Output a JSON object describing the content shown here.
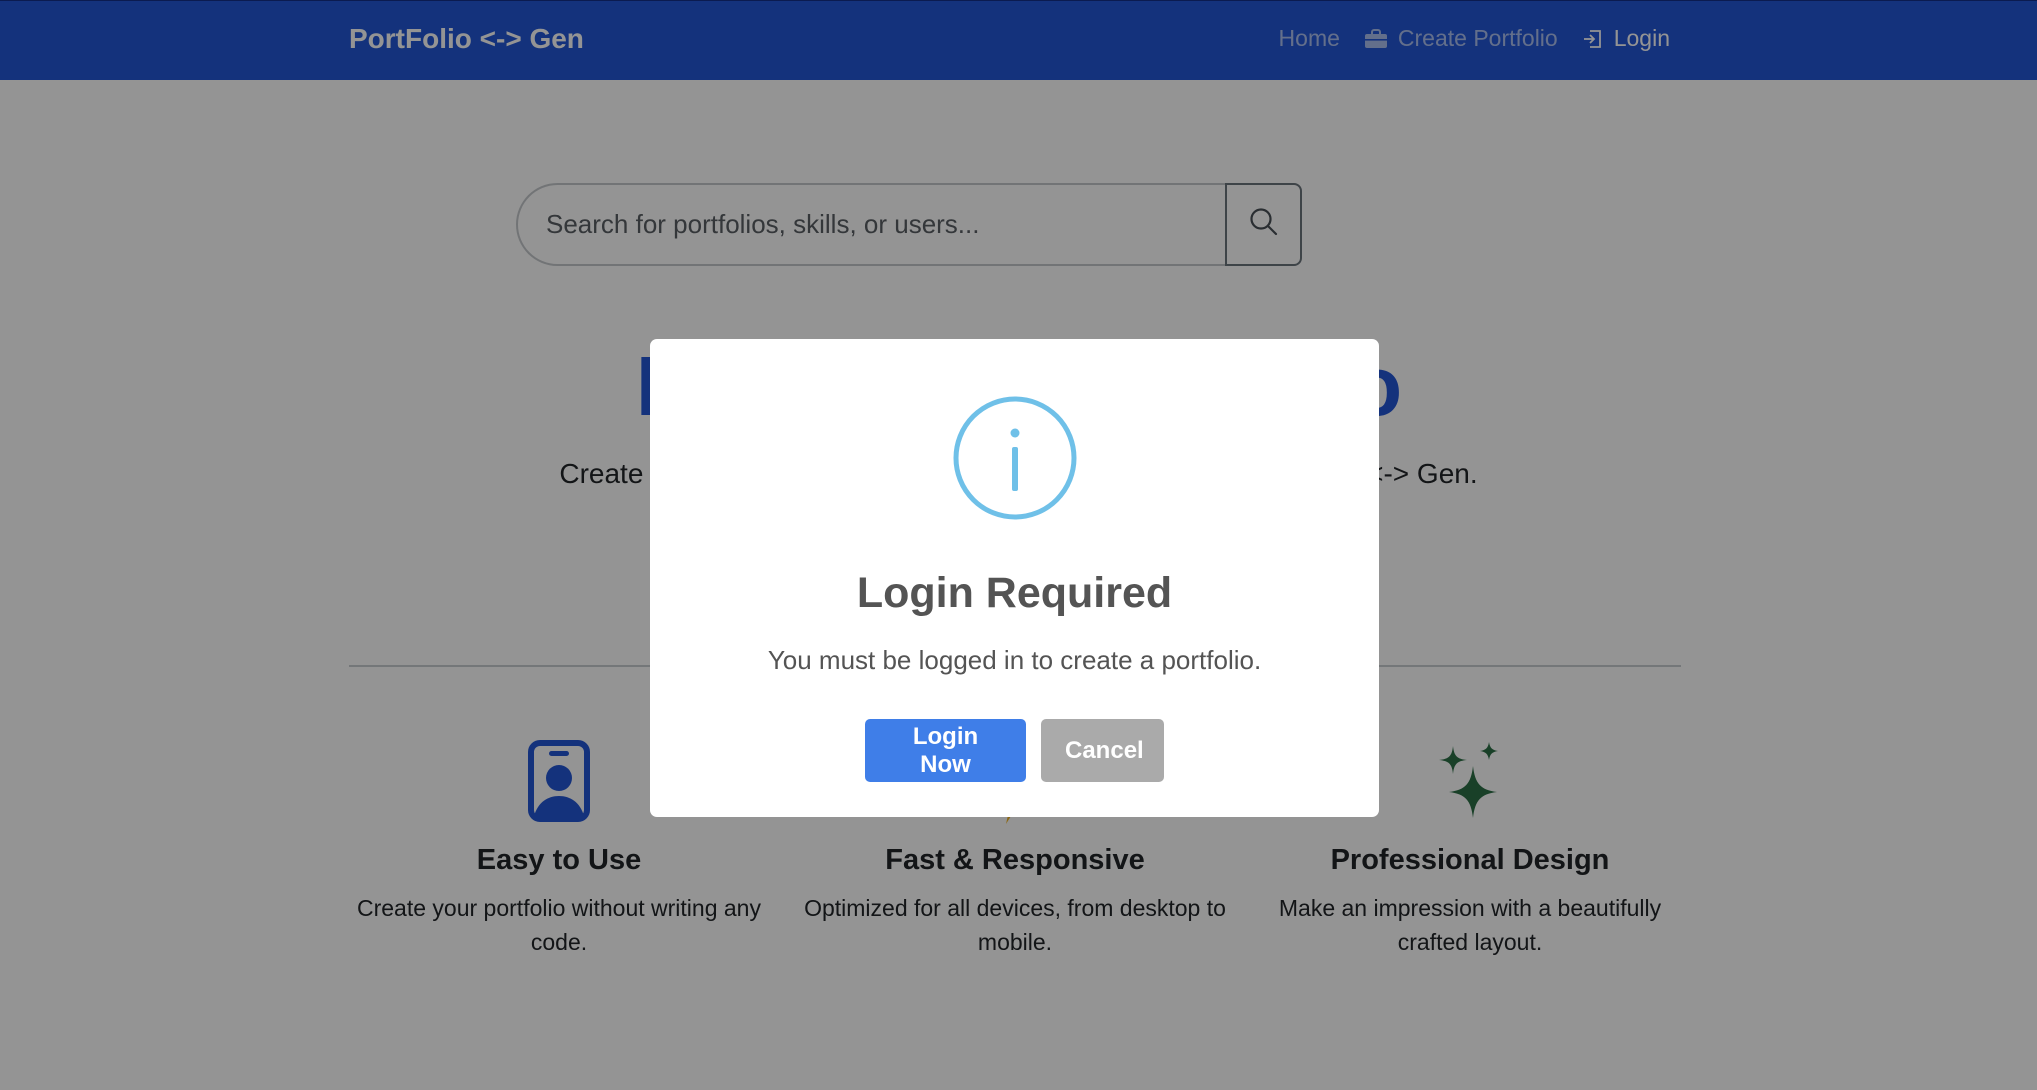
{
  "navbar": {
    "brand": "PortFolio <-> Gen",
    "links": [
      {
        "label": "Home",
        "icon": null
      },
      {
        "label": "Create Portfolio",
        "icon": "briefcase-icon"
      },
      {
        "label": "Login",
        "icon": "login-icon"
      }
    ]
  },
  "search": {
    "placeholder": "Search for portfolios, skills, or users...",
    "value": "",
    "button_icon": "search-icon"
  },
  "hero": {
    "title": "Build Your Portfolio",
    "subtitle": "Create a stunning professional portfolio in minutes with PortFolio <-> Gen."
  },
  "features": [
    {
      "icon": "id-badge-icon",
      "title": "Easy to Use",
      "description": "Create your portfolio without writing any code."
    },
    {
      "icon": "lightning-icon",
      "title": "Fast & Responsive",
      "description": "Optimized for all devices, from desktop to mobile."
    },
    {
      "icon": "sparkles-icon",
      "title": "Professional Design",
      "description": "Make an impression with a beautifully crafted layout."
    }
  ],
  "modal": {
    "icon": "info-icon",
    "title": "Login Required",
    "text": "You must be logged in to create a portfolio.",
    "primary_label": "Login Now",
    "cancel_label": "Cancel"
  },
  "colors": {
    "brand_blue": "#2457d6",
    "modal_info": "#6fc0e8",
    "primary_button": "#3f7ee8",
    "cancel_button": "#aaaaaa",
    "sparkle_green": "#2b6e45",
    "lightning_yellow": "#f0b429"
  }
}
